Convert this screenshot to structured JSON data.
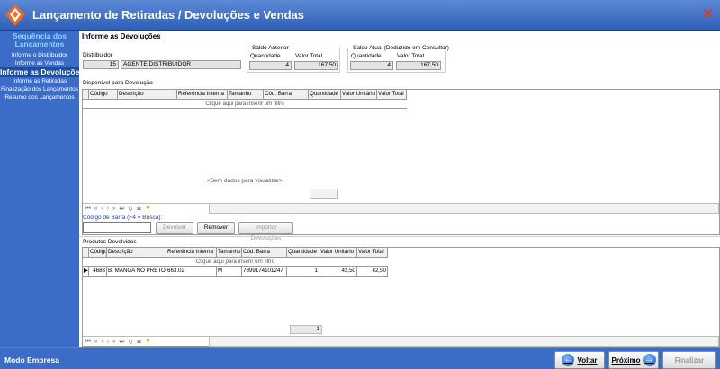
{
  "window": {
    "title": "Lançamento de Retiradas / Devoluções e Vendas"
  },
  "sidebar": {
    "heading": "Sequência dos Lançamentos",
    "items": [
      {
        "label": "Informe o Distribuidor"
      },
      {
        "label": "Informe as Vendas"
      },
      {
        "label": "Informe as Devoluções"
      },
      {
        "label": "Informe as Retiradas"
      },
      {
        "label": "Finalização dos Lançamentos"
      },
      {
        "label": "Resumo dos Lançamentos"
      }
    ]
  },
  "footer": {
    "mode_label": "Modo Empresa",
    "back_label": "Voltar",
    "next_label": "Próximo",
    "finish_label": "Finalizar"
  },
  "main": {
    "section_title": "Informe as Devoluções",
    "distributor": {
      "label": "Distribuidor",
      "code": "15",
      "name": "AGENTE DISTRIBUIDOR"
    },
    "saldo_anterior": {
      "title": "Saldo Anterior",
      "qty_label": "Quantidade",
      "qty": "4",
      "total_label": "Valor Total",
      "total": "167,50"
    },
    "saldo_atual": {
      "title": "Saldo Atual (Deduzido em Consultor)",
      "qty_label": "Quantidade",
      "qty": "4",
      "total_label": "Valor Total",
      "total": "167,50"
    },
    "available": {
      "title": "Disponível para Devolução",
      "columns": [
        "Código",
        "Descrição",
        "Referência Interna",
        "Tamanho",
        "Cód. Barra",
        "Quantidade",
        "Valor Unitário",
        "Valor Total"
      ],
      "filter_text": "Clique aqui para inserir um filtro",
      "empty_text": "<Sem dados para visualizar>"
    },
    "barcode": {
      "label": "Código de Barra (F4 = Busca):",
      "value": ""
    },
    "actions": {
      "return_label": "Devolver",
      "remove_label": "Remover",
      "import_label": "Importar Devoluções"
    },
    "returned": {
      "title": "Produtos Devolvidos",
      "columns": [
        "Código",
        "Descrição",
        "Referência Interna",
        "Tamanho",
        "Cód. Barra",
        "Quantidade",
        "Valor Unitário",
        "Valor Total"
      ],
      "filter_text": "Clique aqui para inserir um filtro",
      "rows": [
        {
          "codigo": "4683",
          "descricao": "B. MANGA NÓ PRETO",
          "ref": "663.02",
          "tamanho": "M",
          "barra": "7899174101247",
          "qtd": "1",
          "unit": "42,50",
          "total": "42,50"
        }
      ],
      "footer_qty": "1"
    }
  }
}
